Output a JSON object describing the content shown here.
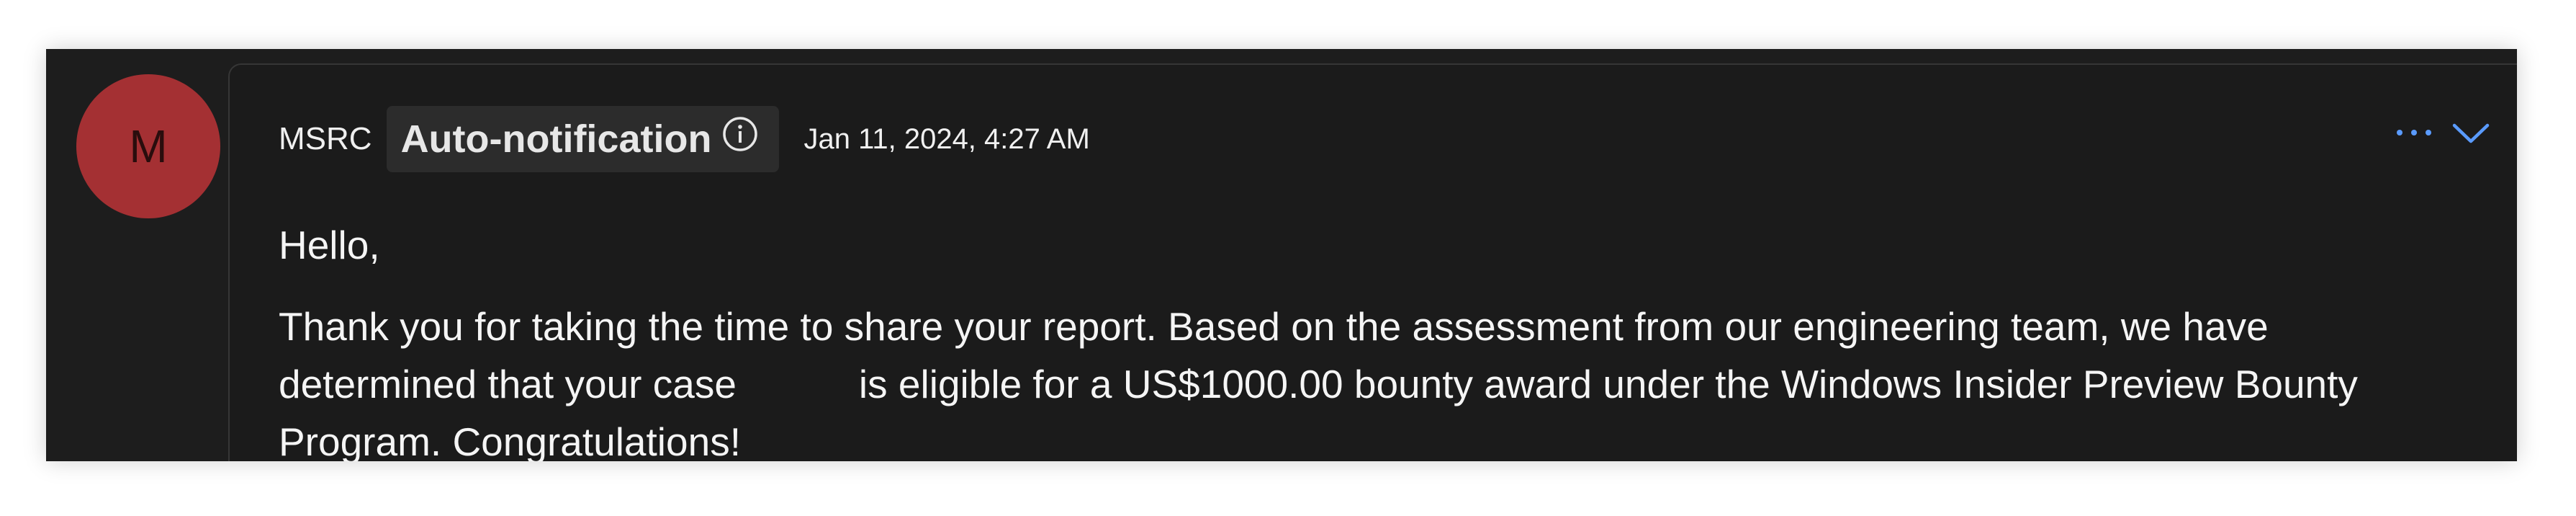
{
  "avatar": {
    "initial": "M",
    "color": "#a43033"
  },
  "message": {
    "sender": "MSRC",
    "badge_label": "Auto-notification",
    "timestamp": "Jan 11, 2024, 4:27 AM",
    "greeting": "Hello,",
    "line1": "Thank you for taking the time to share your report. Based on the assessment from our engineering team, we have",
    "line2_before": "determined that your case",
    "line2_after": "is eligible for a US$1000.00 bounty award under the Windows Insider Preview Bounty",
    "line3": "Program. Congratulations!"
  },
  "icons": {
    "info": "info-icon",
    "more": "more-options-icon",
    "expand": "chevron-down-icon"
  },
  "colors": {
    "accent": "#5a9bff",
    "background": "#1b1b1b"
  }
}
